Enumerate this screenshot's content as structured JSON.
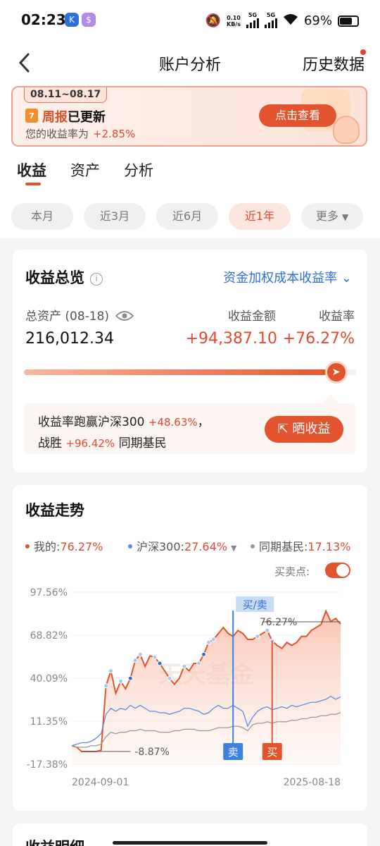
{
  "status_bar": {
    "time": "02:23",
    "net_speed": "0.10",
    "net_unit": "KB/s",
    "sig1": "5G",
    "sig2": "5G",
    "battery": "69%"
  },
  "header": {
    "title": "账户分析",
    "history": "历史数据"
  },
  "banner": {
    "date_range": "08.11~08.17",
    "title_hl": "周报",
    "title_rest": "已更新",
    "subtitle": "您的收益率为",
    "rate": "+2.85%",
    "cta": "点击查看"
  },
  "tabs": [
    "收益",
    "资产",
    "分析"
  ],
  "filters": [
    "本月",
    "近3月",
    "近6月",
    "近1年",
    "更多"
  ],
  "overview": {
    "title": "收益总览",
    "mode": "资金加权成本收益率",
    "total_assets_label": "总资产 (08-18)",
    "total_assets": "216,012.34",
    "profit_label": "收益金额",
    "profit": "+94,387.10",
    "rate_label": "收益率",
    "rate": "+76.27%",
    "progress": 0.94,
    "tip_line1_a": "收益率跑赢沪深300",
    "tip_line1_b": "+48.63%",
    "tip_line1_c": "，",
    "tip_line2_a": "战胜",
    "tip_line2_b": "+96.42%",
    "tip_line2_c": "同期基民",
    "share": "晒收益"
  },
  "trend": {
    "title": "收益走势",
    "legend": [
      {
        "label": "我的:",
        "value": "76.27%",
        "color": "#e2542e"
      },
      {
        "label": "沪深300:",
        "value": "27.64%",
        "color": "#5b8de0"
      },
      {
        "label": "同期基民:",
        "value": "17.13%",
        "color": "#999999"
      }
    ],
    "trade_points_label": "买卖点:",
    "watermark": "天天基金",
    "buy_sell_label": "买/卖",
    "sell_label": "卖",
    "buy_label": "买",
    "max_label": "76.27%",
    "min_label": "-8.87%"
  },
  "chart_data": {
    "type": "line",
    "yticks": [
      "97.56%",
      "68.82%",
      "40.09%",
      "11.35%",
      "-17.38%"
    ],
    "ylim": [
      -17.38,
      97.56
    ],
    "x_start": "2024-09-01",
    "x_end": "2025-08-18",
    "series": [
      {
        "name": "我的",
        "values": [
          -5,
          -6,
          -8.87,
          -8.87,
          -8.87,
          -8.87,
          -8,
          35,
          45,
          30,
          38,
          33,
          40,
          52,
          56,
          48,
          55,
          54,
          50,
          45,
          40,
          36,
          40,
          48,
          45,
          50,
          50,
          56,
          64,
          66,
          70,
          74,
          70,
          68,
          72,
          70,
          66,
          66,
          68,
          70,
          72,
          65,
          62,
          60,
          64,
          62,
          64,
          68,
          68,
          72,
          74,
          76,
          85,
          78,
          80,
          76.27
        ]
      },
      {
        "name": "沪深300",
        "values": [
          -5,
          -4,
          -3,
          -3,
          -2,
          0,
          3,
          16,
          20,
          18,
          20,
          19,
          22,
          20,
          22,
          20,
          18,
          18,
          17,
          17,
          16,
          17,
          18,
          20,
          20,
          19,
          18,
          16,
          17,
          20,
          22,
          20,
          20,
          22,
          20,
          18,
          8,
          14,
          18,
          20,
          21,
          19,
          20,
          21,
          20,
          22,
          21,
          22,
          23,
          24,
          24,
          25,
          26,
          28,
          26,
          27.64
        ]
      },
      {
        "name": "同期基民",
        "values": [
          -5,
          -6,
          -6,
          -6,
          -5,
          -5,
          -4,
          1,
          4,
          3,
          4,
          4,
          5,
          5,
          6,
          5,
          5,
          5,
          4,
          4,
          4,
          5,
          5,
          6,
          6,
          6,
          5,
          5,
          5,
          6,
          7,
          7,
          7,
          8,
          8,
          7,
          5,
          9,
          10,
          10,
          11,
          10,
          11,
          11,
          11,
          12,
          12,
          13,
          13,
          14,
          14,
          15,
          15,
          16,
          16,
          17.13
        ]
      }
    ]
  },
  "bottom": {
    "detail_title": "收益明细"
  }
}
